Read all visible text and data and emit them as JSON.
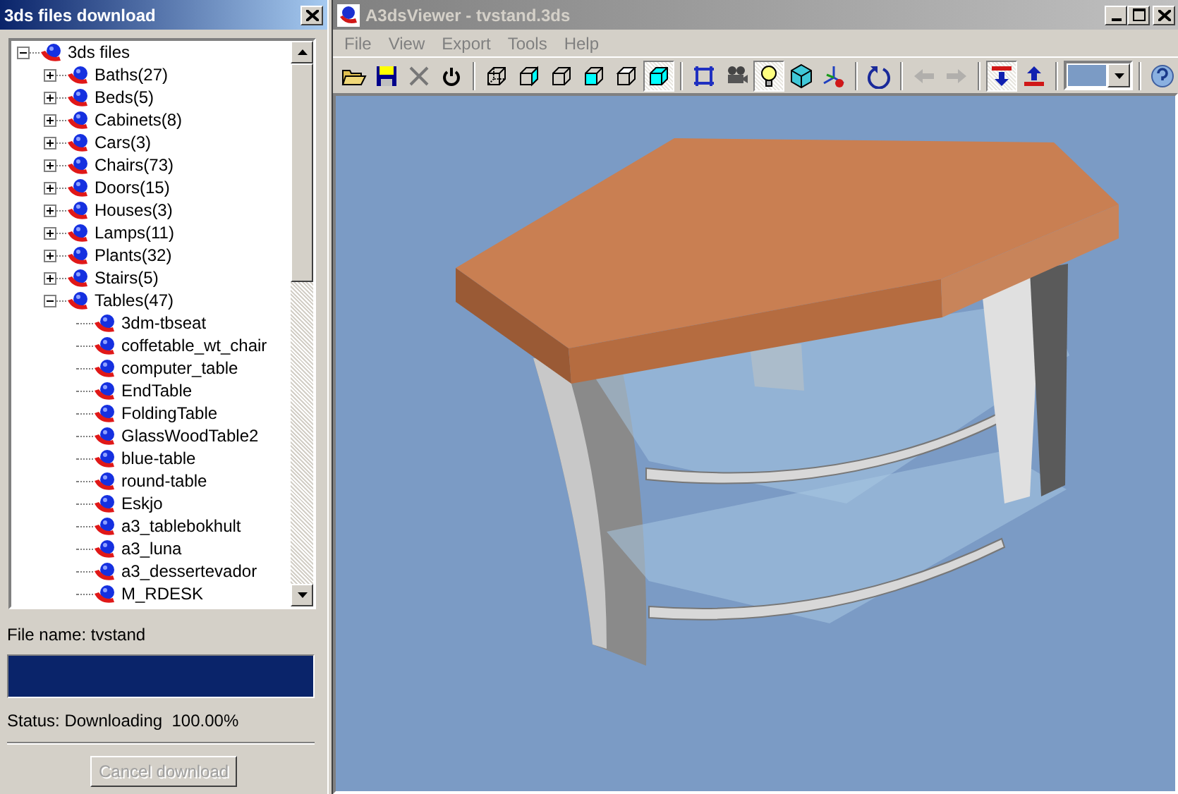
{
  "download_panel": {
    "title": "3ds files download",
    "tree": [
      {
        "label": "3ds files",
        "expanded": true,
        "children": [
          {
            "label": "Baths(27)",
            "expanded": false
          },
          {
            "label": "Beds(5)",
            "expanded": false
          },
          {
            "label": "Cabinets(8)",
            "expanded": false
          },
          {
            "label": "Cars(3)",
            "expanded": false
          },
          {
            "label": "Chairs(73)",
            "expanded": false
          },
          {
            "label": "Doors(15)",
            "expanded": false
          },
          {
            "label": "Houses(3)",
            "expanded": false
          },
          {
            "label": "Lamps(11)",
            "expanded": false
          },
          {
            "label": "Plants(32)",
            "expanded": false
          },
          {
            "label": "Stairs(5)",
            "expanded": false
          },
          {
            "label": "Tables(47)",
            "expanded": true,
            "children": [
              {
                "label": "3dm-tbseat"
              },
              {
                "label": "coffetable_wt_chair"
              },
              {
                "label": "computer_table"
              },
              {
                "label": "EndTable"
              },
              {
                "label": "FoldingTable"
              },
              {
                "label": "GlassWoodTable2"
              },
              {
                "label": "blue-table"
              },
              {
                "label": "round-table"
              },
              {
                "label": "Eskjo"
              },
              {
                "label": "a3_tablebokhult"
              },
              {
                "label": "a3_luna"
              },
              {
                "label": "a3_dessertevador"
              },
              {
                "label": "M_RDESK"
              }
            ]
          }
        ]
      }
    ],
    "file_name": "File name: tvstand",
    "progress": {
      "level": 1.0
    },
    "status": "Status: Downloading  100.00%",
    "cancel_button": {
      "label": "Cancel download",
      "disabled": true
    }
  },
  "viewer": {
    "title": "A3dsViewer - tvstand.3ds",
    "menu": [
      "File",
      "View",
      "Export",
      "Tools",
      "Help"
    ],
    "toolbar": [
      {
        "kind": "open",
        "pressed": false,
        "disabled": false
      },
      {
        "kind": "save",
        "pressed": false,
        "disabled": false
      },
      {
        "kind": "delete",
        "pressed": false,
        "disabled": false
      },
      {
        "kind": "power",
        "pressed": false,
        "disabled": false
      },
      {
        "kind": "sep"
      },
      {
        "kind": "wire",
        "pressed": false,
        "disabled": false
      },
      {
        "kind": "wireside",
        "pressed": false,
        "disabled": false
      },
      {
        "kind": "wirefront",
        "pressed": false,
        "disabled": false
      },
      {
        "kind": "solidfront",
        "pressed": false,
        "disabled": false
      },
      {
        "kind": "solidtop",
        "pressed": false,
        "disabled": false
      },
      {
        "kind": "solid",
        "pressed": true,
        "disabled": false
      },
      {
        "kind": "sep"
      },
      {
        "kind": "frame",
        "pressed": false,
        "disabled": false
      },
      {
        "kind": "camera",
        "pressed": false,
        "disabled": false
      },
      {
        "kind": "light",
        "pressed": true,
        "disabled": false
      },
      {
        "kind": "box",
        "pressed": false,
        "disabled": false
      },
      {
        "kind": "axes",
        "pressed": false,
        "disabled": false
      },
      {
        "kind": "sep"
      },
      {
        "kind": "rotate",
        "pressed": false,
        "disabled": false
      },
      {
        "kind": "sep"
      },
      {
        "kind": "back",
        "pressed": false,
        "disabled": true
      },
      {
        "kind": "forward",
        "pressed": false,
        "disabled": true
      },
      {
        "kind": "sep"
      },
      {
        "kind": "down",
        "pressed": true,
        "disabled": false
      },
      {
        "kind": "up",
        "pressed": false,
        "disabled": false
      },
      {
        "kind": "sep"
      },
      {
        "kind": "color",
        "color": "#7b9bc5"
      },
      {
        "kind": "sep"
      },
      {
        "kind": "help",
        "pressed": false,
        "disabled": false
      }
    ]
  }
}
